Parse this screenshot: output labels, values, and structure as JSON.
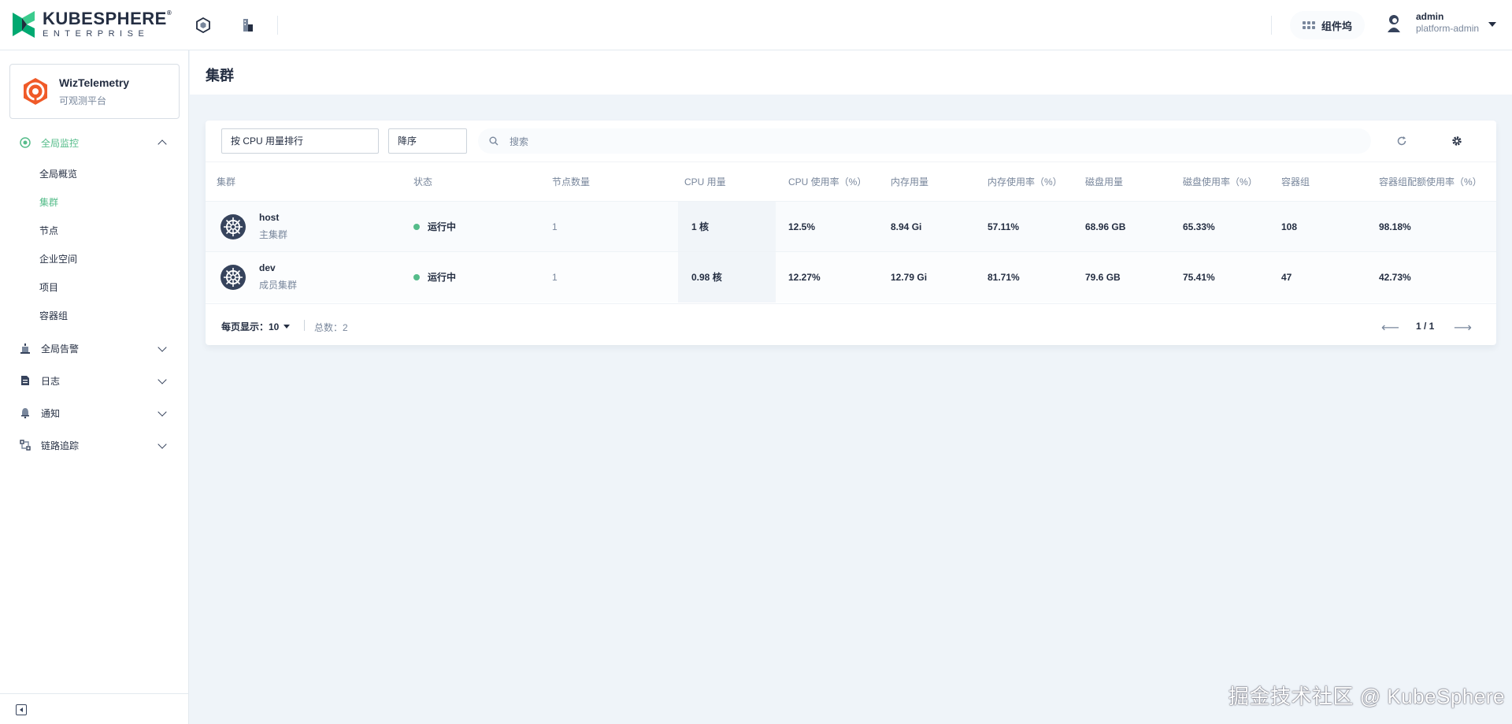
{
  "brand": {
    "name": "KUBESPHERE",
    "sub": "ENTERPRISE",
    "reg": "®"
  },
  "topbar": {
    "component_label": "组件坞",
    "user_name": "admin",
    "user_role": "platform-admin"
  },
  "app": {
    "name": "WizTelemetry",
    "desc": "可观测平台"
  },
  "sidebar": {
    "groups": [
      {
        "label": "全局监控",
        "icon": "monitor-icon"
      },
      {
        "label": "全局告警",
        "icon": "alert-icon"
      },
      {
        "label": "日志",
        "icon": "log-icon"
      },
      {
        "label": "通知",
        "icon": "notify-icon"
      },
      {
        "label": "链路追踪",
        "icon": "trace-icon"
      }
    ],
    "subitems": [
      "全局概览",
      "集群",
      "节点",
      "企业空间",
      "项目",
      "容器组"
    ]
  },
  "page": {
    "title": "集群"
  },
  "toolbar": {
    "sort_by": "按 CPU 用量排行",
    "order": "降序",
    "search_placeholder": "搜索"
  },
  "table": {
    "columns": [
      "集群",
      "状态",
      "节点数量",
      "CPU 用量",
      "CPU 使用率（%）",
      "内存用量",
      "内存使用率（%）",
      "磁盘用量",
      "磁盘使用率（%）",
      "容器组",
      "容器组配额使用率（%）"
    ],
    "rows": [
      {
        "name": "host",
        "role": "主集群",
        "status": "运行中",
        "nodes": "1",
        "cpu": "1 核",
        "cpu_rate": "12.5%",
        "mem": "8.94 Gi",
        "mem_rate": "57.11%",
        "disk": "68.96 GB",
        "disk_rate": "65.33%",
        "pods": "108",
        "pod_rate": "98.18%"
      },
      {
        "name": "dev",
        "role": "成员集群",
        "status": "运行中",
        "nodes": "1",
        "cpu": "0.98 核",
        "cpu_rate": "12.27%",
        "mem": "12.79 Gi",
        "mem_rate": "81.71%",
        "disk": "79.6 GB",
        "disk_rate": "75.41%",
        "pods": "47",
        "pod_rate": "42.73%"
      }
    ]
  },
  "pager": {
    "per_page": "每页显示：10",
    "total": "总数：2",
    "page": "1 / 1"
  },
  "watermark": "掘金技术社区 @ KubeSphere",
  "colors": {
    "accent": "#55bc8a",
    "text": "#242e42",
    "muted": "#79879c",
    "bg": "#eff4f9"
  }
}
